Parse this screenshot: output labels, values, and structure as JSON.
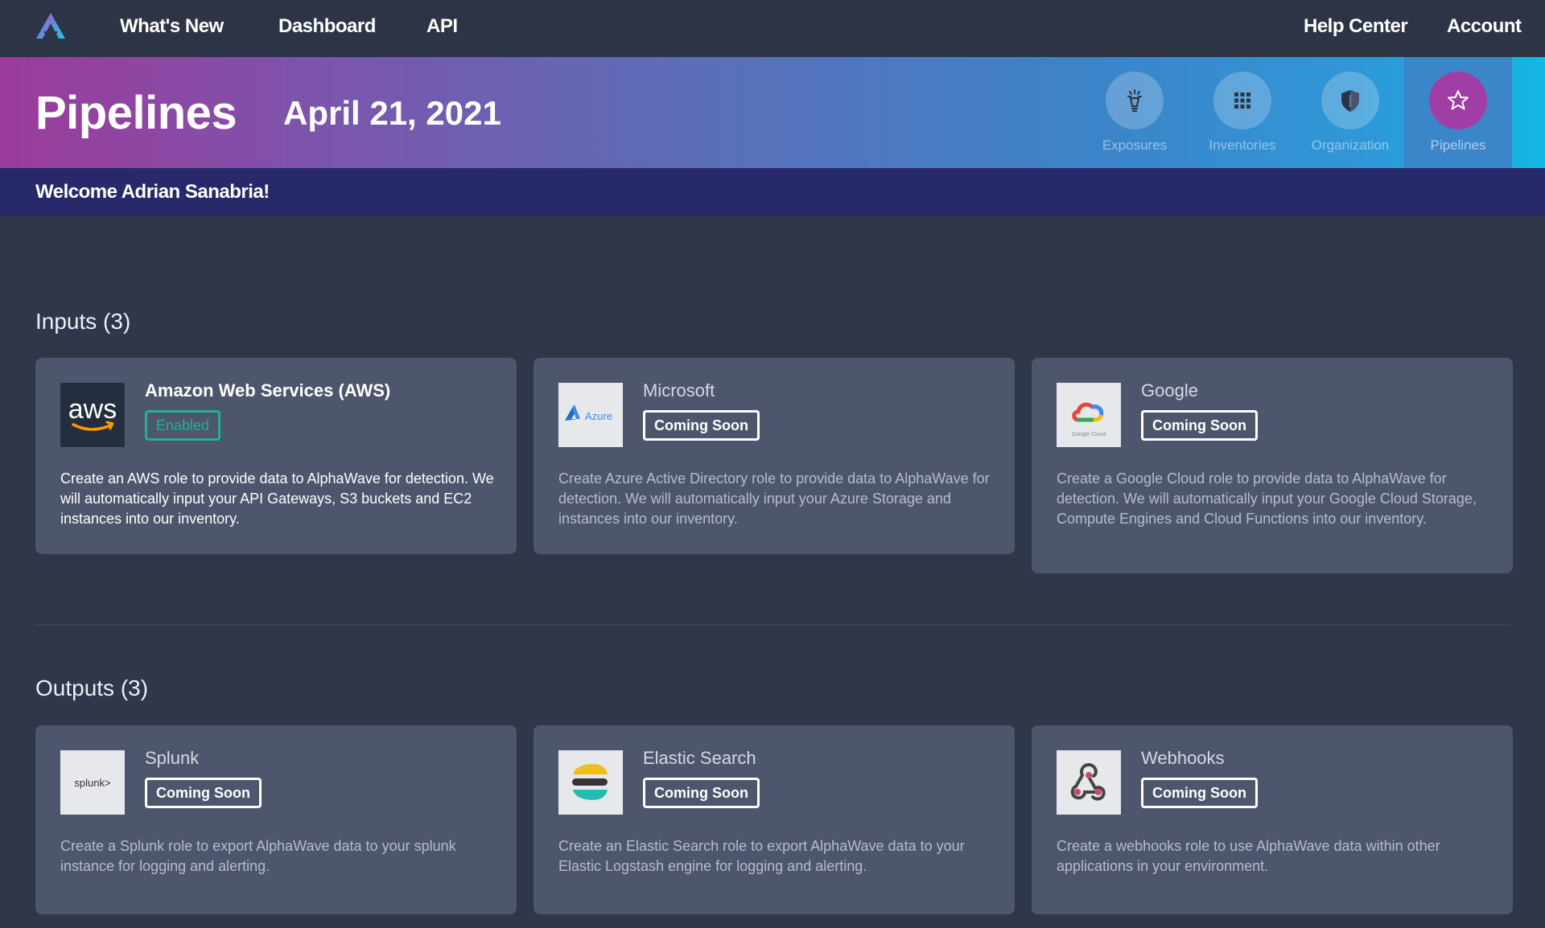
{
  "nav": {
    "links": [
      "What's New",
      "Dashboard",
      "API"
    ],
    "right_links": [
      "Help Center",
      "Account"
    ]
  },
  "banner": {
    "title": "Pipelines",
    "date": "April 21, 2021",
    "quicknav": [
      {
        "label": "Exposures",
        "icon": "lightbulb-icon"
      },
      {
        "label": "Inventories",
        "icon": "grid-icon"
      },
      {
        "label": "Organization",
        "icon": "shield-icon"
      },
      {
        "label": "Pipelines",
        "icon": "star-icon",
        "active": true
      }
    ]
  },
  "welcome": "Welcome Adrian Sanabria!",
  "inputs": {
    "title": "Inputs (3)",
    "cards": [
      {
        "name": "Amazon Web Services (AWS)",
        "status": "Enabled",
        "logo_text": "aws",
        "description": "Create an AWS role to provide data to AlphaWave for detection. We will automatically input your API Gateways, S3 buckets and EC2 instances into our inventory."
      },
      {
        "name": "Microsoft",
        "status": "Coming Soon",
        "logo_text": "Azure",
        "description": "Create Azure Active Directory role to provide data to AlphaWave for detection. We will automatically input your Azure Storage and instances into our inventory."
      },
      {
        "name": "Google",
        "status": "Coming Soon",
        "logo_text": "Google Cloud",
        "description": "Create a Google Cloud role to provide data to AlphaWave for detection. We will automatically input your Google Cloud Storage, Compute Engines and Cloud Functions into our inventory."
      }
    ]
  },
  "outputs": {
    "title": "Outputs (3)",
    "cards": [
      {
        "name": "Splunk",
        "status": "Coming Soon",
        "logo_text": "splunk>",
        "description": "Create a Splunk role to export AlphaWave data to your splunk instance for logging and alerting."
      },
      {
        "name": "Elastic Search",
        "status": "Coming Soon",
        "description": "Create an Elastic Search role to export AlphaWave data to your Elastic Logstash engine for logging and alerting."
      },
      {
        "name": "Webhooks",
        "status": "Coming Soon",
        "description": "Create a webhooks role to use AlphaWave data within other applications in your environment."
      }
    ]
  },
  "colors": {
    "enabled": "#1fb19a",
    "card": "#4d566c",
    "page": "#2f3749",
    "welcome_bar": "#27296a",
    "active_quicknav": "#a13ea6"
  }
}
